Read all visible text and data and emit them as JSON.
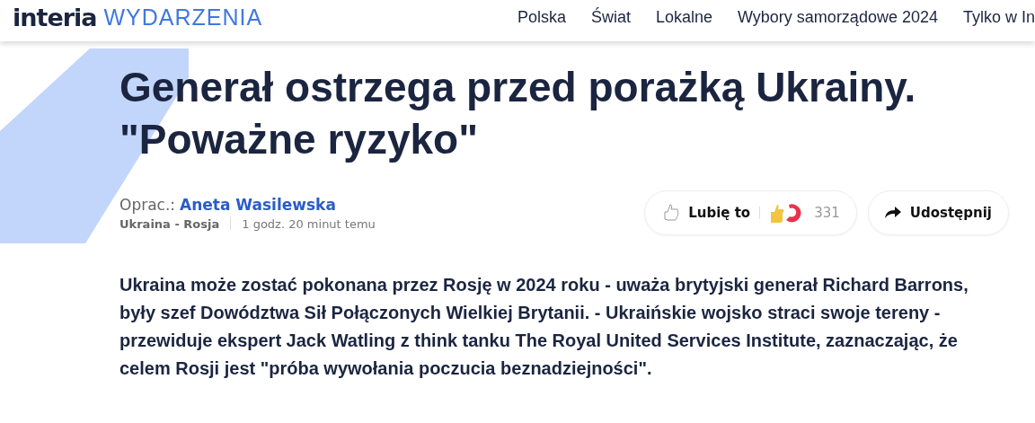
{
  "header": {
    "logo": "interia",
    "section": "WYDARZENIA",
    "nav": [
      "Polska",
      "Świat",
      "Lokalne",
      "Wybory samorządowe 2024",
      "Tylko w In"
    ]
  },
  "article": {
    "title": "Generał ostrzega przed porażką Ukrainy. \"Poważne ryzyko\"",
    "byline_label": "Oprac.:",
    "author": "Aneta Wasilewska",
    "category": "Ukraina - Rosja",
    "time": "1 godz. 20 minut temu",
    "like": {
      "label": "Lubię to",
      "count": "331"
    },
    "share": {
      "label": "Udostępnij"
    },
    "lead": "Ukraina może zostać pokonana przez Rosję w 2024 roku - uważa brytyjski generał Richard Barrons, były szef Dowództwa Sił Połączonych Wielkiej Brytanii. - Ukraińskie wojsko straci swoje tereny - przewiduje ekspert Jack Watling z think tanku The Royal United Services Institute, zaznaczając, że celem Rosji jest \"próba wywołania poczucia beznadziejności\"."
  }
}
